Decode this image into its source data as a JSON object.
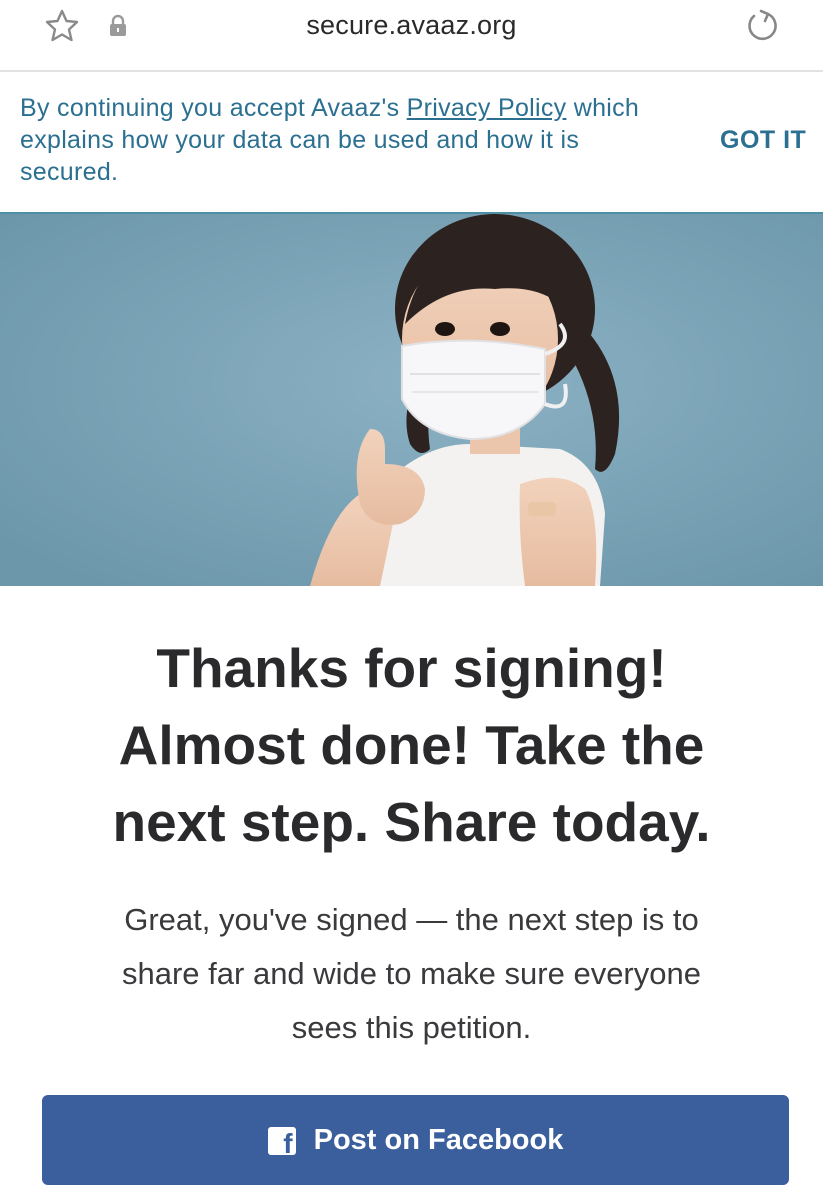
{
  "browser": {
    "url": "secure.avaaz.org",
    "icons": [
      "star-icon",
      "lock-icon",
      "reload-icon"
    ]
  },
  "consent": {
    "text_before": "By continuing you accept Avaaz's ",
    "link_label": "Privacy Policy",
    "text_after": " which explains how your data can be used and how it is secured.",
    "button_label": "GOT IT"
  },
  "hero": {
    "icons": [
      "child-thumbs-up-photo"
    ]
  },
  "main": {
    "headline_lines": [
      "Thanks for signing!",
      "Almost done! Take the",
      "next step. Share today."
    ],
    "body_lines": [
      "Great, you've signed — the next step is to",
      "share far and wide to make sure everyone",
      "sees this petition."
    ],
    "facebook_button": {
      "label": "Post on Facebook",
      "icon": "facebook-icon",
      "icon_glyph": "f"
    }
  },
  "colors": {
    "accent": "#2b6f91",
    "facebook": "#3b5e9d",
    "hero_bg": "#7da4b7"
  }
}
